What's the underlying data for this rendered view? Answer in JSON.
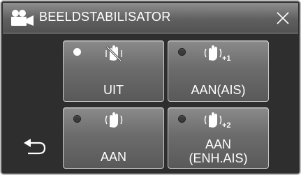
{
  "header": {
    "title": "BEELDSTABILISATOR",
    "mode_icon": "video-camera-icon",
    "close_icon": "close-icon"
  },
  "options": [
    {
      "id": "uit",
      "label": "UIT",
      "icon": "stabilizer-off-icon",
      "selected": true
    },
    {
      "id": "aan-ais",
      "label": "AAN(AIS)",
      "icon": "stabilizer-ais-icon",
      "icon_suffix": "+1",
      "selected": false
    },
    {
      "id": "aan",
      "label": "AAN",
      "icon": "stabilizer-on-icon",
      "selected": false
    },
    {
      "id": "aan-enh",
      "label": "AAN\n(ENH.AIS)",
      "icon": "stabilizer-enh-ais-icon",
      "icon_suffix": "+2",
      "selected": false
    }
  ],
  "back_icon": "return-arrow-icon",
  "colors": {
    "background": "#2e2e2e",
    "tile": "#6c6c6c",
    "header": "#5f5f5f",
    "text": "#ffffff"
  }
}
